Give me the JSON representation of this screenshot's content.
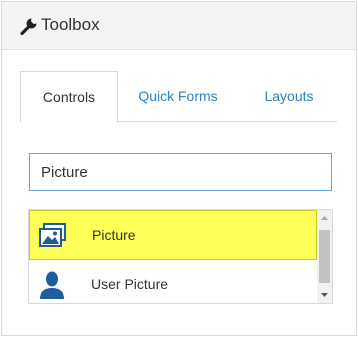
{
  "header": {
    "title": "Toolbox",
    "icon": "wrench-icon"
  },
  "tabs": [
    {
      "label": "Controls",
      "active": true
    },
    {
      "label": "Quick Forms",
      "active": false
    },
    {
      "label": "Layouts",
      "active": false
    }
  ],
  "search": {
    "value": "Picture"
  },
  "results": [
    {
      "label": "Picture",
      "icon": "picture-icon",
      "highlighted": true
    },
    {
      "label": "User Picture",
      "icon": "user-icon",
      "highlighted": false
    }
  ],
  "colors": {
    "highlight": "#ffff5a",
    "link": "#2a82c8",
    "icon": "#1e5c9a"
  }
}
